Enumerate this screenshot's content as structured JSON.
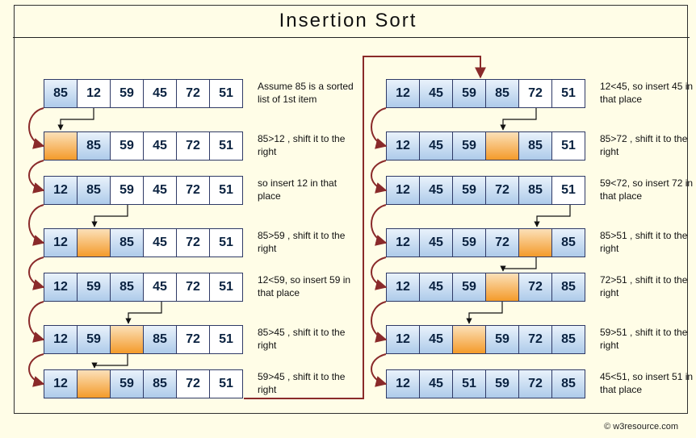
{
  "title": "Insertion  Sort",
  "attribution": "w3resource.com",
  "colors": {
    "cell_blue_top": "#e9f2fb",
    "cell_blue_bot": "#aecbea",
    "cell_orange_top": "#fbe0b9",
    "cell_orange_bot": "#f49b2a",
    "arrow": "#8a2a2a",
    "bg": "#fffde7"
  },
  "left": [
    {
      "cells": [
        {
          "v": "85",
          "c": "blue"
        },
        {
          "v": "12",
          "c": "white"
        },
        {
          "v": "59",
          "c": "white"
        },
        {
          "v": "45",
          "c": "white"
        },
        {
          "v": "72",
          "c": "white"
        },
        {
          "v": "51",
          "c": "white"
        }
      ],
      "caption": "Assume 85 is a sorted list of 1st item"
    },
    {
      "cells": [
        {
          "v": "",
          "c": "orange"
        },
        {
          "v": "85",
          "c": "blue"
        },
        {
          "v": "59",
          "c": "white"
        },
        {
          "v": "45",
          "c": "white"
        },
        {
          "v": "72",
          "c": "white"
        },
        {
          "v": "51",
          "c": "white"
        }
      ],
      "caption": "85>12 , shift it to the right"
    },
    {
      "cells": [
        {
          "v": "12",
          "c": "blue"
        },
        {
          "v": "85",
          "c": "blue"
        },
        {
          "v": "59",
          "c": "white"
        },
        {
          "v": "45",
          "c": "white"
        },
        {
          "v": "72",
          "c": "white"
        },
        {
          "v": "51",
          "c": "white"
        }
      ],
      "caption": "so insert 12 in that place"
    },
    {
      "cells": [
        {
          "v": "12",
          "c": "blue"
        },
        {
          "v": "",
          "c": "orange"
        },
        {
          "v": "85",
          "c": "blue"
        },
        {
          "v": "45",
          "c": "white"
        },
        {
          "v": "72",
          "c": "white"
        },
        {
          "v": "51",
          "c": "white"
        }
      ],
      "caption": "85>59 , shift it to the right"
    },
    {
      "cells": [
        {
          "v": "12",
          "c": "blue"
        },
        {
          "v": "59",
          "c": "blue"
        },
        {
          "v": "85",
          "c": "blue"
        },
        {
          "v": "45",
          "c": "white"
        },
        {
          "v": "72",
          "c": "white"
        },
        {
          "v": "51",
          "c": "white"
        }
      ],
      "caption": "12<59, so insert 59 in that place"
    },
    {
      "cells": [
        {
          "v": "12",
          "c": "blue"
        },
        {
          "v": "59",
          "c": "blue"
        },
        {
          "v": "",
          "c": "orange"
        },
        {
          "v": "85",
          "c": "blue"
        },
        {
          "v": "72",
          "c": "white"
        },
        {
          "v": "51",
          "c": "white"
        }
      ],
      "caption": "85>45 , shift it to the right"
    },
    {
      "cells": [
        {
          "v": "12",
          "c": "blue"
        },
        {
          "v": "",
          "c": "orange"
        },
        {
          "v": "59",
          "c": "blue"
        },
        {
          "v": "85",
          "c": "blue"
        },
        {
          "v": "72",
          "c": "white"
        },
        {
          "v": "51",
          "c": "white"
        }
      ],
      "caption": "59>45 , shift it to the right"
    }
  ],
  "right": [
    {
      "cells": [
        {
          "v": "12",
          "c": "blue"
        },
        {
          "v": "45",
          "c": "blue"
        },
        {
          "v": "59",
          "c": "blue"
        },
        {
          "v": "85",
          "c": "blue"
        },
        {
          "v": "72",
          "c": "white"
        },
        {
          "v": "51",
          "c": "white"
        }
      ],
      "caption": "12<45, so insert 45 in that place"
    },
    {
      "cells": [
        {
          "v": "12",
          "c": "blue"
        },
        {
          "v": "45",
          "c": "blue"
        },
        {
          "v": "59",
          "c": "blue"
        },
        {
          "v": "",
          "c": "orange"
        },
        {
          "v": "85",
          "c": "blue"
        },
        {
          "v": "51",
          "c": "white"
        }
      ],
      "caption": "85>72 , shift it to the right"
    },
    {
      "cells": [
        {
          "v": "12",
          "c": "blue"
        },
        {
          "v": "45",
          "c": "blue"
        },
        {
          "v": "59",
          "c": "blue"
        },
        {
          "v": "72",
          "c": "blue"
        },
        {
          "v": "85",
          "c": "blue"
        },
        {
          "v": "51",
          "c": "white"
        }
      ],
      "caption": "59<72, so insert 72 in that place"
    },
    {
      "cells": [
        {
          "v": "12",
          "c": "blue"
        },
        {
          "v": "45",
          "c": "blue"
        },
        {
          "v": "59",
          "c": "blue"
        },
        {
          "v": "72",
          "c": "blue"
        },
        {
          "v": "",
          "c": "orange"
        },
        {
          "v": "85",
          "c": "blue"
        }
      ],
      "caption": "85>51 , shift it to the right"
    },
    {
      "cells": [
        {
          "v": "12",
          "c": "blue"
        },
        {
          "v": "45",
          "c": "blue"
        },
        {
          "v": "59",
          "c": "blue"
        },
        {
          "v": "",
          "c": "orange"
        },
        {
          "v": "72",
          "c": "blue"
        },
        {
          "v": "85",
          "c": "blue"
        }
      ],
      "caption": "72>51 , shift it to the right"
    },
    {
      "cells": [
        {
          "v": "12",
          "c": "blue"
        },
        {
          "v": "45",
          "c": "blue"
        },
        {
          "v": "",
          "c": "orange"
        },
        {
          "v": "59",
          "c": "blue"
        },
        {
          "v": "72",
          "c": "blue"
        },
        {
          "v": "85",
          "c": "blue"
        }
      ],
      "caption": "59>51 , shift it to the right"
    },
    {
      "cells": [
        {
          "v": "12",
          "c": "blue"
        },
        {
          "v": "45",
          "c": "blue"
        },
        {
          "v": "51",
          "c": "blue"
        },
        {
          "v": "59",
          "c": "blue"
        },
        {
          "v": "72",
          "c": "blue"
        },
        {
          "v": "85",
          "c": "blue"
        }
      ],
      "caption": "45<51, so insert 51 in that place"
    }
  ],
  "chart_data": {
    "type": "table",
    "title": "Insertion Sort trace",
    "initial": [
      85,
      12,
      59,
      45,
      72,
      51
    ],
    "sorted": [
      12,
      45,
      51,
      59,
      72,
      85
    ],
    "steps": [
      {
        "array": [
          85,
          12,
          59,
          45,
          72,
          51
        ],
        "note": "Assume 85 is a sorted list of 1st item"
      },
      {
        "array": [
          null,
          85,
          59,
          45,
          72,
          51
        ],
        "insert_slot": 0,
        "moving": 12,
        "note": "85>12 shift right"
      },
      {
        "array": [
          12,
          85,
          59,
          45,
          72,
          51
        ],
        "note": "insert 12"
      },
      {
        "array": [
          12,
          null,
          85,
          45,
          72,
          51
        ],
        "insert_slot": 1,
        "moving": 59,
        "note": "85>59 shift right"
      },
      {
        "array": [
          12,
          59,
          85,
          45,
          72,
          51
        ],
        "note": "12<59 insert 59"
      },
      {
        "array": [
          12,
          59,
          null,
          85,
          72,
          51
        ],
        "insert_slot": 2,
        "moving": 45,
        "note": "85>45 shift right"
      },
      {
        "array": [
          12,
          null,
          59,
          85,
          72,
          51
        ],
        "insert_slot": 1,
        "moving": 45,
        "note": "59>45 shift right"
      },
      {
        "array": [
          12,
          45,
          59,
          85,
          72,
          51
        ],
        "note": "12<45 insert 45"
      },
      {
        "array": [
          12,
          45,
          59,
          null,
          85,
          51
        ],
        "insert_slot": 3,
        "moving": 72,
        "note": "85>72 shift right"
      },
      {
        "array": [
          12,
          45,
          59,
          72,
          85,
          51
        ],
        "note": "59<72 insert 72"
      },
      {
        "array": [
          12,
          45,
          59,
          72,
          null,
          85
        ],
        "insert_slot": 4,
        "moving": 51,
        "note": "85>51 shift right"
      },
      {
        "array": [
          12,
          45,
          59,
          null,
          72,
          85
        ],
        "insert_slot": 3,
        "moving": 51,
        "note": "72>51 shift right"
      },
      {
        "array": [
          12,
          45,
          null,
          59,
          72,
          85
        ],
        "insert_slot": 2,
        "moving": 51,
        "note": "59>51 shift right"
      },
      {
        "array": [
          12,
          45,
          51,
          59,
          72,
          85
        ],
        "note": "45<51 insert 51"
      }
    ]
  }
}
